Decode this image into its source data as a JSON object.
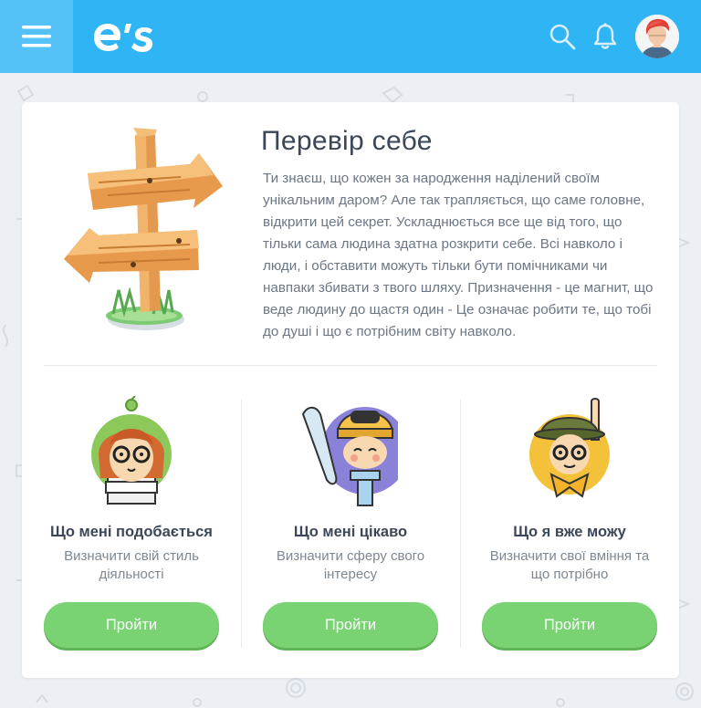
{
  "header": {
    "logo_text": "e's",
    "menu_icon": "hamburger-icon",
    "search_icon": "search-icon",
    "bell_icon": "bell-icon",
    "avatar": "avatar-red-hair"
  },
  "colors": {
    "header": "#2fb4f4",
    "menu_bg": "#54c2f6",
    "button": "#79d372",
    "title": "#3b4758",
    "text": "#6b7785",
    "page_bg": "#ecf0f4"
  },
  "intro": {
    "title": "Перевір себе",
    "description": "Ти знаєш, що кожен за народження наділений своїм унікальним даром? Але так трапляється, що саме головне, відкрити цей секрет. Ускладнюється все ще від того, що тільки сама людина здатна розкрити себе. Всі навколо і люди, і обставити можуть тільки бути помічниками чи навпаки збивати з твого шляху. Призначення - це магнит, що веде людину до щастя один - Це означає робити те, що тобі до душі і що є потрібним світу навколо."
  },
  "tests": [
    {
      "title": "Що мені подобається",
      "subtitle": "Визначити свій стиль діяльності",
      "button": "Пройти",
      "icon": "girl-with-books-icon"
    },
    {
      "title": "Що мені цікаво",
      "subtitle": "Визначити сферу свого інтересу",
      "button": "Пройти",
      "icon": "snowboarder-icon"
    },
    {
      "title": "Що я вже можу",
      "subtitle": "Визначити свої вміння та що потрібно",
      "button": "Пройти",
      "icon": "scout-icon"
    }
  ]
}
